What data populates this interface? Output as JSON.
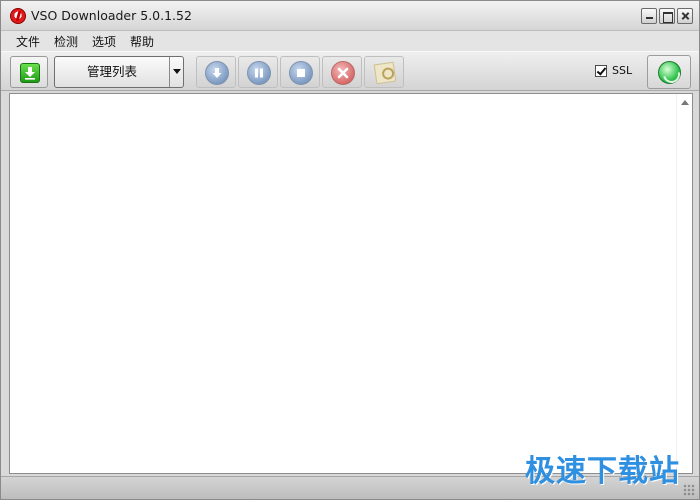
{
  "window": {
    "title": "VSO Downloader 5.0.1.52",
    "icons": {
      "app": "vso-app-icon",
      "minimize": "minimize-icon",
      "maximize": "maximize-icon",
      "close": "close-icon"
    }
  },
  "menu": {
    "items": [
      "文件",
      "检测",
      "选项",
      "帮助"
    ]
  },
  "toolbar": {
    "download_icon": "download-arrow-icon",
    "dropdown_label": "管理列表",
    "dropdown_arrow_icon": "chevron-down-icon",
    "buttons": [
      {
        "icon": "download-circle-icon",
        "enabled": false
      },
      {
        "icon": "pause-circle-icon",
        "enabled": false
      },
      {
        "icon": "stop-circle-icon",
        "enabled": false
      },
      {
        "icon": "cancel-circle-icon",
        "enabled": false
      },
      {
        "icon": "inspect-document-icon",
        "enabled": false
      }
    ],
    "ssl": {
      "label": "SSL",
      "checked": true
    },
    "globe_icon": "globe-icon"
  },
  "list": {
    "items": []
  },
  "watermark": {
    "text": "极速下载站"
  },
  "colors": {
    "watermark": "#2f8fe0",
    "download_green": "#1f9a17",
    "accent_blue": "#7e9bc2",
    "accent_red": "#d86b6b"
  }
}
